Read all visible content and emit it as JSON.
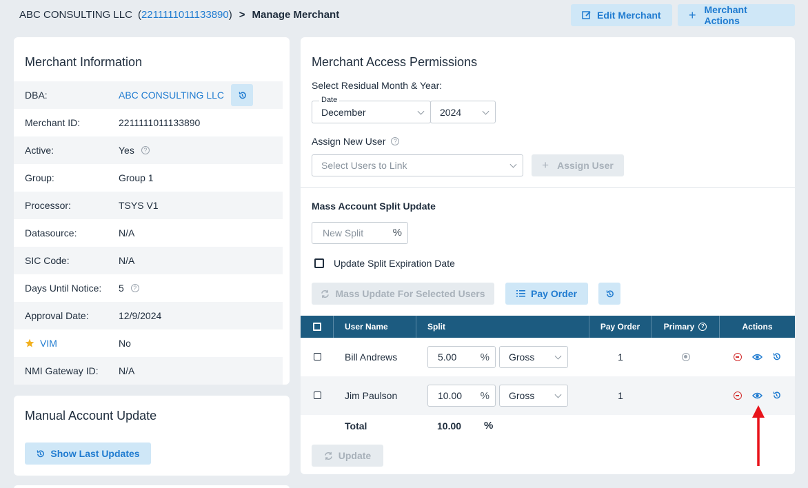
{
  "header": {
    "merchant_name": "ABC CONSULTING LLC",
    "merchant_id_link": "2211111011133890",
    "open_paren": "(",
    "close_paren": ")",
    "separator": ">",
    "page_title": "Manage Merchant",
    "edit_button": "Edit Merchant",
    "actions_button": "Merchant Actions"
  },
  "merchant_info": {
    "title": "Merchant Information",
    "rows": [
      {
        "label": "DBA:",
        "value": "ABC CONSULTING LLC"
      },
      {
        "label": "Merchant ID:",
        "value": "2211111011133890"
      },
      {
        "label": "Active:",
        "value": "Yes"
      },
      {
        "label": "Group:",
        "value": "Group 1"
      },
      {
        "label": "Processor:",
        "value": "TSYS V1"
      },
      {
        "label": "Datasource:",
        "value": "N/A"
      },
      {
        "label": "SIC Code:",
        "value": "N/A"
      },
      {
        "label": "Days Until Notice:",
        "value": "5"
      },
      {
        "label": "Approval Date:",
        "value": "12/9/2024"
      },
      {
        "label": "VIM",
        "value": "No"
      },
      {
        "label": "NMI Gateway ID:",
        "value": "N/A"
      }
    ]
  },
  "manual_update": {
    "title": "Manual Account Update",
    "show_button": "Show Last Updates"
  },
  "permissions": {
    "title": "Merchant Access Permissions",
    "residual_label": "Select Residual Month & Year:",
    "date_legend": "Date",
    "month": "December",
    "year": "2024",
    "assign_label": "Assign New User",
    "select_placeholder": "Select Users to Link",
    "assign_button": "Assign User",
    "mass_title": "Mass Account Split Update",
    "new_split_placeholder": "New Split",
    "pct_symbol": "%",
    "expiration_label": "Update Split Expiration Date",
    "mass_update_button": "Mass Update For Selected Users",
    "pay_order_button": "Pay Order",
    "update_button": "Update"
  },
  "table": {
    "headers": {
      "user": "User Name",
      "split": "Split",
      "pay_order": "Pay Order",
      "primary": "Primary",
      "actions": "Actions"
    },
    "rows": [
      {
        "name": "Bill Andrews",
        "split": "5.00",
        "basis": "Gross",
        "pay_order": "1",
        "primary": true
      },
      {
        "name": "Jim Paulson",
        "split": "10.00",
        "basis": "Gross",
        "pay_order": "1",
        "primary": false
      }
    ],
    "total_label": "Total",
    "total_value": "10.00",
    "total_pct": "%"
  },
  "colors": {
    "accent": "#1f7bd0",
    "header_bg": "#1c5b80",
    "danger": "#d32f2f",
    "annotation": "#e8141b"
  }
}
